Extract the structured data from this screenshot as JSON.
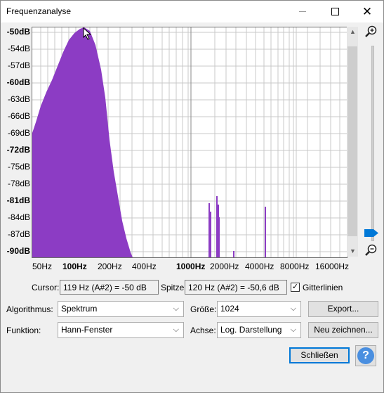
{
  "window": {
    "title": "Frequenzanalyse"
  },
  "plot": {
    "y_ticks": [
      "-50dB",
      "-54dB",
      "-57dB",
      "-60dB",
      "-63dB",
      "-66dB",
      "-69dB",
      "-72dB",
      "-75dB",
      "-78dB",
      "-81dB",
      "-84dB",
      "-87dB",
      "-90dB"
    ],
    "y_bold": [
      "-50dB",
      "-60dB",
      "-72dB",
      "-81dB",
      "-90dB"
    ],
    "x_ticks": [
      "50Hz",
      "100Hz",
      "200Hz",
      "400Hz",
      "1000Hz",
      "2000Hz",
      "4000Hz",
      "8000Hz",
      "16000Hz"
    ],
    "x_bold": [
      "100Hz",
      "1000Hz"
    ],
    "fill_color": "#8c3cc4"
  },
  "cursor": {
    "label": "Cursor:",
    "value": "119 Hz (A#2) = -50 dB"
  },
  "peak": {
    "label": "Spitze:",
    "value": "120 Hz (A#2) = -50,6 dB"
  },
  "grid": {
    "label": "Gitterlinien",
    "checked": true
  },
  "algorithm": {
    "label": "Algorithmus:",
    "value": "Spektrum"
  },
  "size": {
    "label": "Größe:",
    "value": "1024"
  },
  "function": {
    "label": "Funktion:",
    "value": "Hann-Fenster"
  },
  "axis": {
    "label": "Achse:",
    "value": "Log. Darstellung"
  },
  "buttons": {
    "export": "Export...",
    "redraw": "Neu zeichnen...",
    "close": "Schließen",
    "help": "?"
  }
}
